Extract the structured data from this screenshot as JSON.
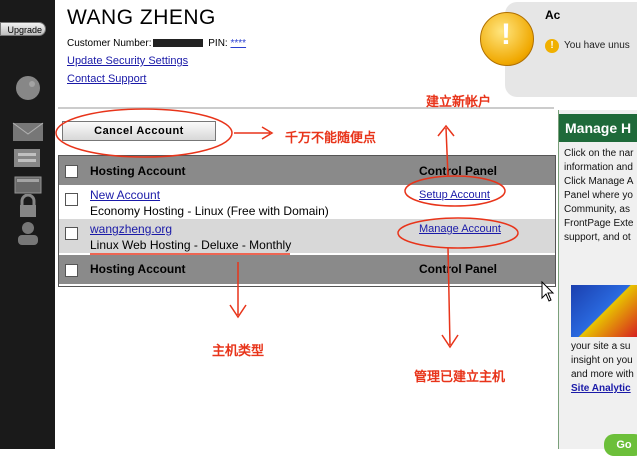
{
  "sidebar": {
    "upgrade_label": "Upgrade"
  },
  "header": {
    "user_name": "WANG ZHENG",
    "customer_number_label": "Customer Number:",
    "pin_label": "PIN:",
    "pin_value": "****",
    "update_security_link": "Update Security Settings",
    "contact_support_link": "Contact Support"
  },
  "alert": {
    "title": "Ac",
    "message": "You have unus"
  },
  "actions": {
    "cancel_account_label": "Cancel Account"
  },
  "table": {
    "header_hosting": "Hosting Account",
    "header_control": "Control Panel",
    "footer_hosting": "Hosting Account",
    "footer_control": "Control Panel",
    "rows": [
      {
        "name": "New Account",
        "type": "Economy Hosting - Linux (Free with Domain)",
        "action": "Setup Account"
      },
      {
        "name": "wangzheng.org",
        "type": "Linux Web Hosting - Deluxe - Monthly",
        "action": "Manage Account"
      }
    ]
  },
  "right_panel": {
    "title": "Manage H",
    "text_lines": [
      "Click on the nar",
      "information and",
      "Click Manage A",
      "Panel where yo",
      "Community, as",
      "FrontPage Exte",
      "support, and ot"
    ],
    "lower_lines": [
      "your site a su",
      "insight on you",
      "and more with"
    ],
    "analytics_link": "Site Analytic",
    "go_label": "Go"
  },
  "annotations": {
    "create_account": "建立新帐户",
    "do_not_click": "千万不能随便点",
    "host_type": "主机类型",
    "manage_host": "管理已建立主机"
  },
  "colors": {
    "annotation_red": "#e8341a",
    "table_header_gray": "#8a8a8a",
    "panel_green": "#1f6a3a",
    "link_blue": "#1a1aa8"
  }
}
